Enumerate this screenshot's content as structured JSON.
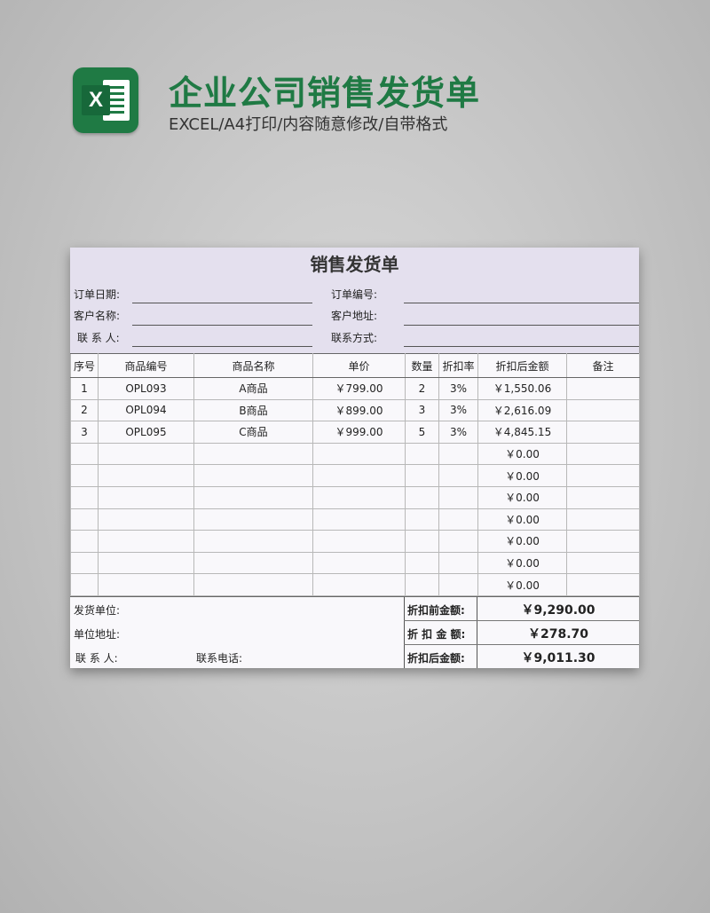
{
  "header": {
    "icon": "excel-icon",
    "icon_letter": "X",
    "title": "企业公司销售发货单",
    "subtitle": "EXCEL/A4打印/内容随意修改/自带格式"
  },
  "sheet": {
    "title": "销售发货单",
    "info": {
      "order_date_label": "订单日期:",
      "customer_name_label": "客户名称:",
      "contact_label": "联 系 人:",
      "order_no_label": "订单编号:",
      "customer_addr_label": "客户地址:",
      "contact_method_label": "联系方式:"
    },
    "columns": [
      "序号",
      "商品编号",
      "商品名称",
      "单价",
      "数量",
      "折扣率",
      "折扣后金额",
      "备注"
    ],
    "rows": [
      [
        "1",
        "OPL093",
        "A商品",
        "￥799.00",
        "2",
        "3%",
        "￥1,550.06",
        ""
      ],
      [
        "2",
        "OPL094",
        "B商品",
        "￥899.00",
        "3",
        "3%",
        "￥2,616.09",
        ""
      ],
      [
        "3",
        "OPL095",
        "C商品",
        "￥999.00",
        "5",
        "3%",
        "￥4,845.15",
        ""
      ],
      [
        "",
        "",
        "",
        "",
        "",
        "",
        "￥0.00",
        ""
      ],
      [
        "",
        "",
        "",
        "",
        "",
        "",
        "￥0.00",
        ""
      ],
      [
        "",
        "",
        "",
        "",
        "",
        "",
        "￥0.00",
        ""
      ],
      [
        "",
        "",
        "",
        "",
        "",
        "",
        "￥0.00",
        ""
      ],
      [
        "",
        "",
        "",
        "",
        "",
        "",
        "￥0.00",
        ""
      ],
      [
        "",
        "",
        "",
        "",
        "",
        "",
        "￥0.00",
        ""
      ],
      [
        "",
        "",
        "",
        "",
        "",
        "",
        "￥0.00",
        ""
      ]
    ],
    "footer": {
      "shipper_label": "发货单位:",
      "shipper_addr_label": "单位地址:",
      "contact_label": "联  系  人:",
      "phone_label": "联系电话:",
      "pre_discount_label": "折扣前金额:",
      "pre_discount_value": "￥9,290.00",
      "discount_label": "折 扣 金 额:",
      "discount_value": "￥278.70",
      "post_discount_label": "折扣后金额:",
      "post_discount_value": "￥9,011.30"
    }
  }
}
